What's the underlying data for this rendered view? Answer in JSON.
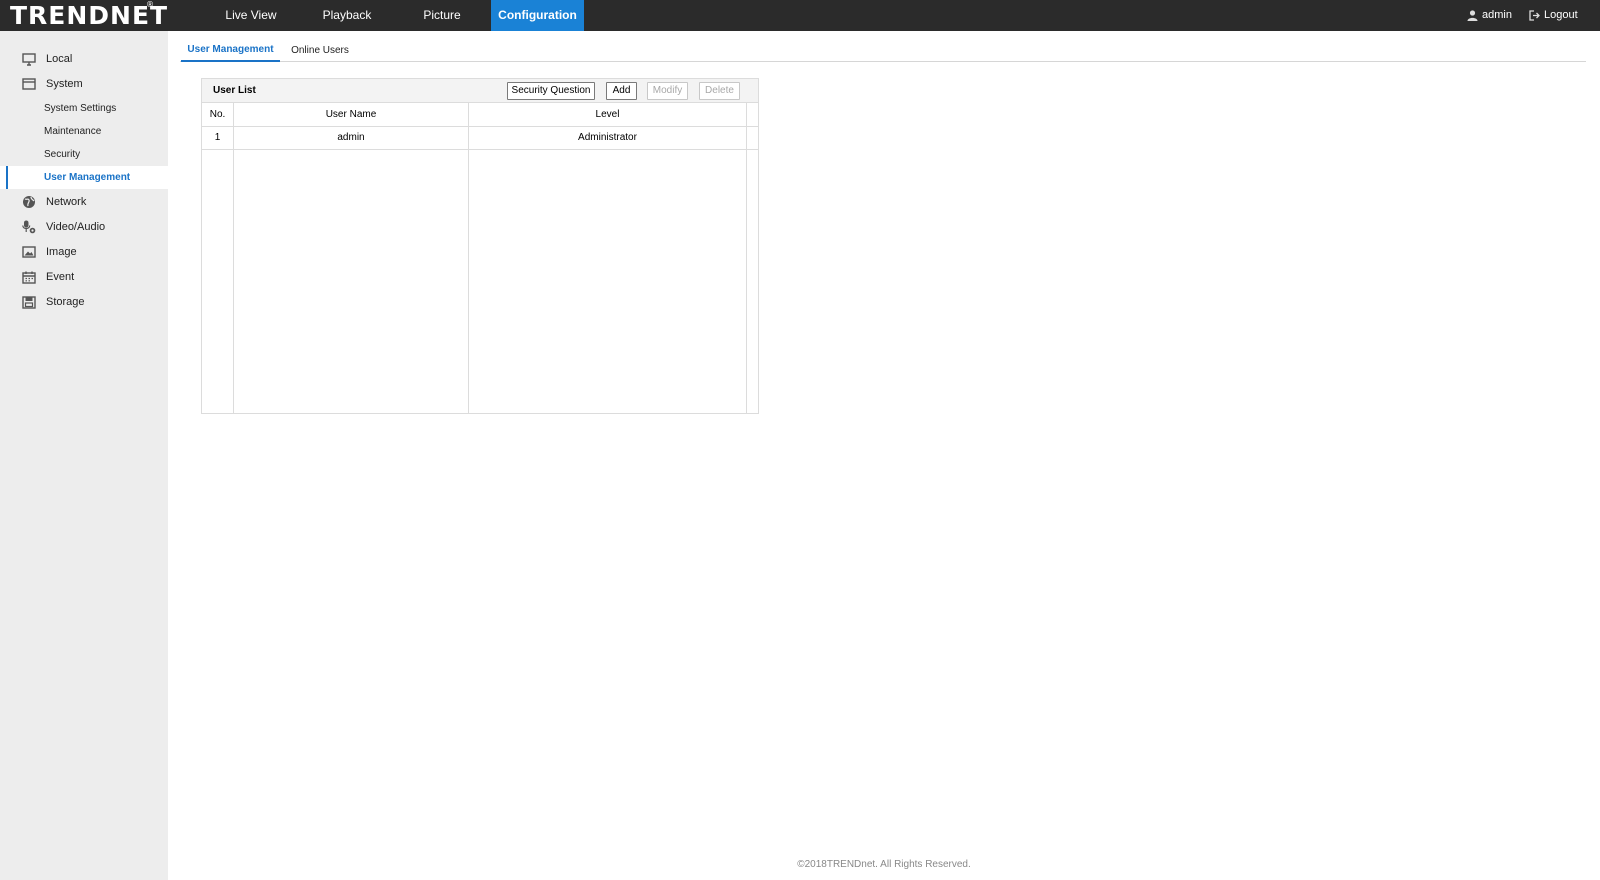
{
  "header": {
    "logo_text": "TRENDNET",
    "logo_mark": "®",
    "nav": [
      "Live View",
      "Playback",
      "Picture",
      "Configuration"
    ],
    "active_nav": "Configuration",
    "user": "admin",
    "logout": "Logout"
  },
  "sidebar": {
    "items": [
      {
        "label": "Local",
        "icon": "monitor-icon"
      },
      {
        "label": "System",
        "icon": "system-icon"
      },
      {
        "label": "Network",
        "icon": "globe-icon"
      },
      {
        "label": "Video/Audio",
        "icon": "microphone-icon"
      },
      {
        "label": "Image",
        "icon": "image-icon"
      },
      {
        "label": "Event",
        "icon": "calendar-icon"
      },
      {
        "label": "Storage",
        "icon": "storage-icon"
      }
    ],
    "system_sub": [
      "System Settings",
      "Maintenance",
      "Security",
      "User Management"
    ],
    "active_sub": "User Management"
  },
  "tabs": [
    "User Management",
    "Online Users"
  ],
  "user_list": {
    "title": "User List",
    "buttons": {
      "security_question": "Security Question",
      "add": "Add",
      "modify": "Modify",
      "delete": "Delete"
    },
    "columns": [
      "No.",
      "User Name",
      "Level"
    ],
    "rows": [
      {
        "no": "1",
        "user_name": "admin",
        "level": "Administrator"
      }
    ]
  },
  "footer": "©2018TRENDnet. All Rights Reserved.",
  "colors": {
    "header_bg": "#2b2b2b",
    "accent": "#1a82d6",
    "sidebar_bg": "#ededed"
  }
}
